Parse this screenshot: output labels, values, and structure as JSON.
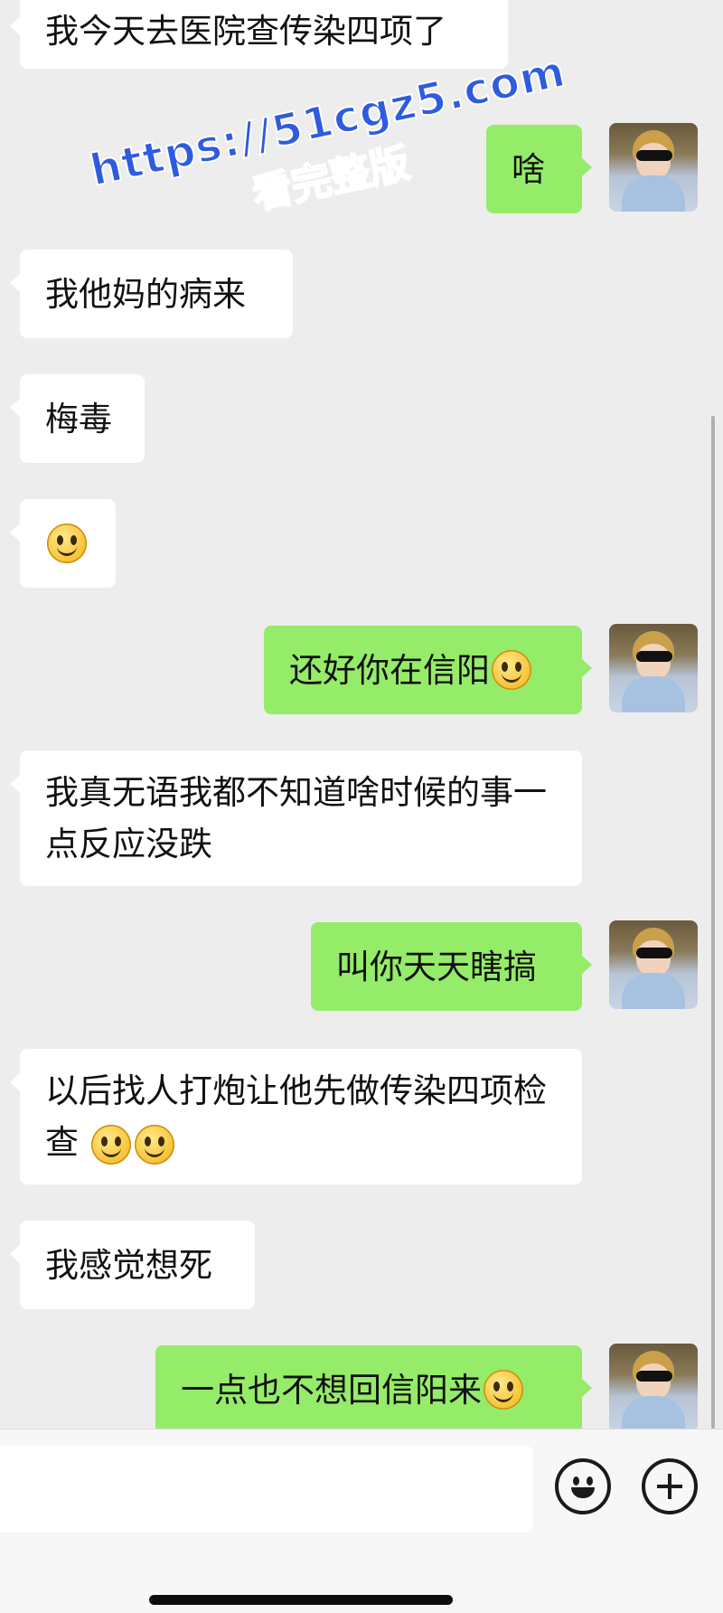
{
  "messages": [
    {
      "side": "in",
      "text": "我今天去医院查传染四项了",
      "emoji": 0
    },
    {
      "side": "out",
      "text": "啥",
      "emoji": 0
    },
    {
      "side": "in",
      "text": "我他妈的病来",
      "emoji": 0
    },
    {
      "side": "in",
      "text": "梅毒",
      "emoji": 0
    },
    {
      "side": "in",
      "text": "",
      "emoji": 1
    },
    {
      "side": "out",
      "text": "还好你在信阳",
      "emoji": 1
    },
    {
      "side": "in",
      "text": "我真无语我都不知道啥时候的事一点反应没跌",
      "emoji": 0
    },
    {
      "side": "out",
      "text": "叫你天天瞎搞",
      "emoji": 0
    },
    {
      "side": "in",
      "text": "以后找人打炮让他先做传染四项检查",
      "emoji": 2
    },
    {
      "side": "in",
      "text": "我感觉想死",
      "emoji": 0
    },
    {
      "side": "out",
      "text": "一点也不想回信阳来",
      "emoji": 1
    }
  ],
  "watermark": {
    "url": "https://51cgz5.com",
    "text": "看完整版"
  },
  "input": {
    "value": "",
    "emoji_icon": "smiley-face-icon",
    "plus_icon": "plus-circle-icon"
  },
  "colors": {
    "background": "#ededed",
    "incoming_bubble": "#ffffff",
    "outgoing_bubble": "#95ec69",
    "watermark": "#2f5be0"
  }
}
